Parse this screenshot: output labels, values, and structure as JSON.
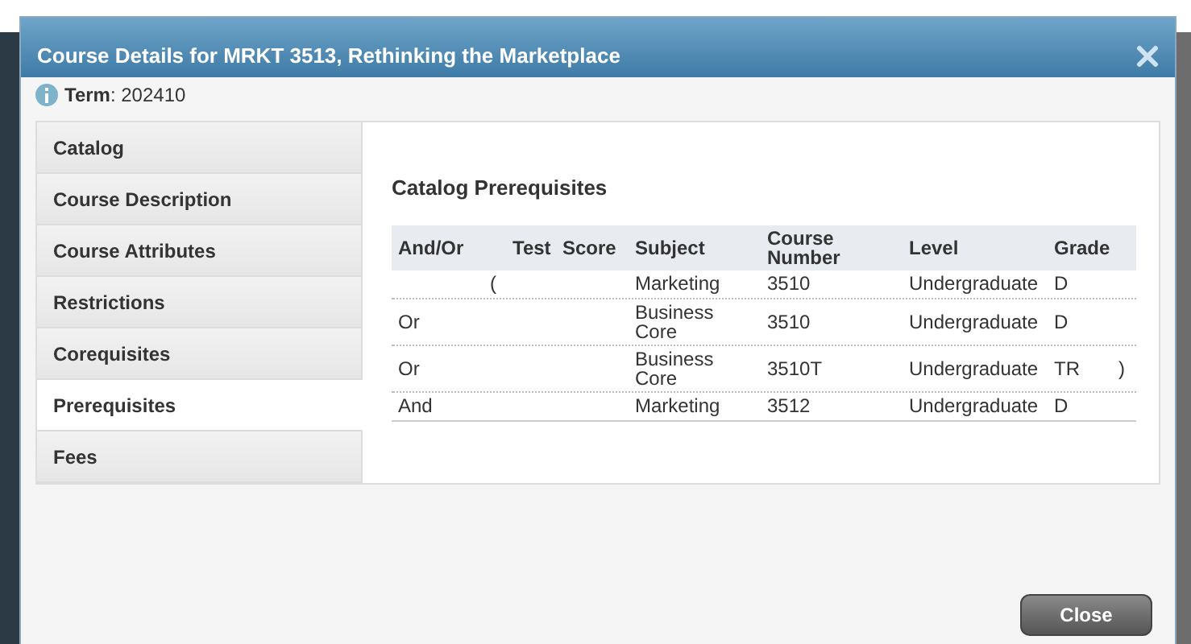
{
  "window": {
    "title": "Course Details for MRKT 3513, Rethinking the Marketplace"
  },
  "term": "**Term**: 202410",
  "tabs": [
    {
      "label": "Catalog",
      "selected": false
    },
    {
      "label": "Course Description",
      "selected": false
    },
    {
      "label": "Course Attributes",
      "selected": false
    },
    {
      "label": "Restrictions",
      "selected": false
    },
    {
      "label": "Corequisites",
      "selected": false
    },
    {
      "label": "Prerequisites",
      "selected": true
    },
    {
      "label": "Fees",
      "selected": false
    }
  ],
  "section_title": "Catalog Prerequisites",
  "table": {
    "columns": [
      "And/Or",
      "Test",
      "Score",
      "Subject",
      "Course Number",
      "Level",
      "Grade"
    ],
    "rows": [
      {
        "open_paren": "(",
        "subject": "Marketing",
        "course_number": "3510",
        "level": "Undergraduate",
        "grade": "D"
      },
      {
        "and_or": "Or",
        "subject": "Business Core",
        "course_number": "3510",
        "level": "Undergraduate",
        "grade": "D"
      },
      {
        "and_or": "Or",
        "subject": "Business Core",
        "course_number": "3510T",
        "level": "Undergraduate",
        "grade": "TR",
        "close_paren": ")"
      },
      {
        "and_or": "And",
        "subject": "Marketing",
        "course_number": "3512",
        "level": "Undergraduate",
        "grade": "D"
      }
    ]
  },
  "buttons": [
    "Close"
  ]
}
